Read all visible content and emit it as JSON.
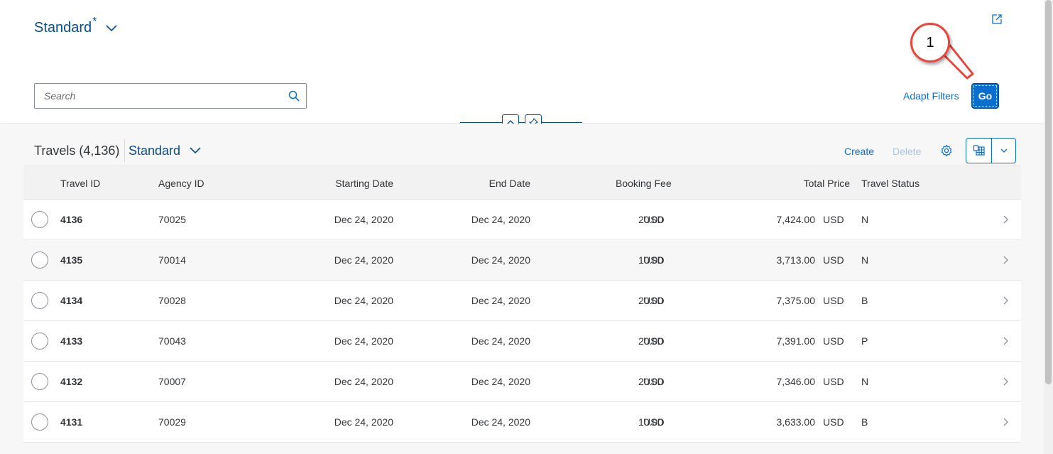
{
  "header": {
    "variant_title": "Standard",
    "variant_modified_marker": "*",
    "search_placeholder": "Search",
    "adapt_filters_label": "Adapt Filters",
    "go_label": "Go"
  },
  "callout": {
    "number": "1",
    "color": "#e8453c"
  },
  "table": {
    "title": "Travels (4,136)",
    "variant_label": "Standard",
    "create_label": "Create",
    "delete_label": "Delete",
    "columns": [
      "Travel ID",
      "Agency ID",
      "Starting Date",
      "End Date",
      "Booking Fee",
      "Total Price",
      "Travel Status"
    ],
    "rows": [
      {
        "travel_id": "4136",
        "agency_id": "70025",
        "start_date": "Dec 24, 2020",
        "end_date": "Dec 24, 2020",
        "booking_fee": "20.00",
        "fee_currency": "USD",
        "total_price": "7,424.00",
        "price_currency": "USD",
        "status": "N"
      },
      {
        "travel_id": "4135",
        "agency_id": "70014",
        "start_date": "Dec 24, 2020",
        "end_date": "Dec 24, 2020",
        "booking_fee": "10.00",
        "fee_currency": "USD",
        "total_price": "3,713.00",
        "price_currency": "USD",
        "status": "N"
      },
      {
        "travel_id": "4134",
        "agency_id": "70028",
        "start_date": "Dec 24, 2020",
        "end_date": "Dec 24, 2020",
        "booking_fee": "20.00",
        "fee_currency": "USD",
        "total_price": "7,375.00",
        "price_currency": "USD",
        "status": "B"
      },
      {
        "travel_id": "4133",
        "agency_id": "70043",
        "start_date": "Dec 24, 2020",
        "end_date": "Dec 24, 2020",
        "booking_fee": "20.00",
        "fee_currency": "USD",
        "total_price": "7,391.00",
        "price_currency": "USD",
        "status": "P"
      },
      {
        "travel_id": "4132",
        "agency_id": "70007",
        "start_date": "Dec 24, 2020",
        "end_date": "Dec 24, 2020",
        "booking_fee": "20.00",
        "fee_currency": "USD",
        "total_price": "7,346.00",
        "price_currency": "USD",
        "status": "N"
      },
      {
        "travel_id": "4131",
        "agency_id": "70029",
        "start_date": "Dec 24, 2020",
        "end_date": "Dec 24, 2020",
        "booking_fee": "10.00",
        "fee_currency": "USD",
        "total_price": "3,633.00",
        "price_currency": "USD",
        "status": "B"
      }
    ]
  },
  "icons": {
    "variant_dropdown": "chevron-down-icon",
    "share": "share-icon",
    "search": "search-icon",
    "collapse_header": "chevron-up-icon",
    "pin_header": "pin-icon",
    "table_settings": "gear-icon",
    "export": "spreadsheet-export-icon",
    "export_menu": "chevron-down-icon",
    "row_navigation": "chevron-right-icon"
  },
  "colors": {
    "brand": "#0a6ed1",
    "title_blue": "#0a4b8c",
    "text": "#32363a",
    "disabled_link": "#a8c6e8"
  }
}
